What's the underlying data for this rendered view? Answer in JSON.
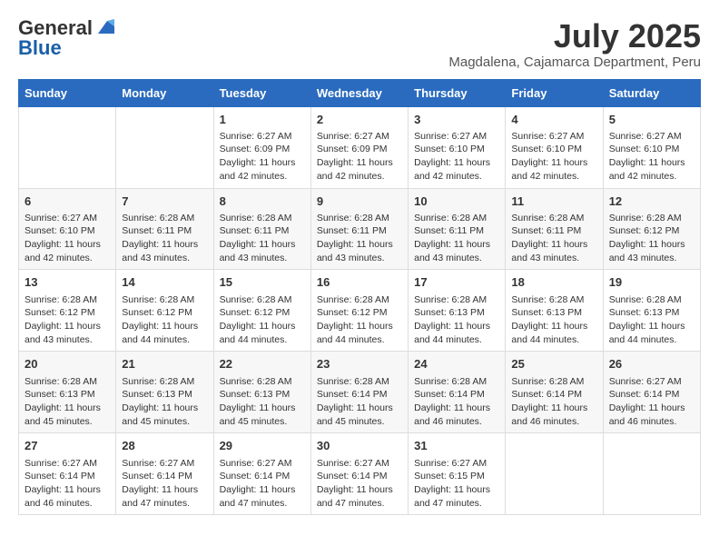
{
  "logo": {
    "general": "General",
    "blue": "Blue"
  },
  "title": {
    "month_year": "July 2025",
    "location": "Magdalena, Cajamarca Department, Peru"
  },
  "days_of_week": [
    "Sunday",
    "Monday",
    "Tuesday",
    "Wednesday",
    "Thursday",
    "Friday",
    "Saturday"
  ],
  "weeks": [
    [
      {
        "day": "",
        "info": ""
      },
      {
        "day": "",
        "info": ""
      },
      {
        "day": "1",
        "info": "Sunrise: 6:27 AM\nSunset: 6:09 PM\nDaylight: 11 hours and 42 minutes."
      },
      {
        "day": "2",
        "info": "Sunrise: 6:27 AM\nSunset: 6:09 PM\nDaylight: 11 hours and 42 minutes."
      },
      {
        "day": "3",
        "info": "Sunrise: 6:27 AM\nSunset: 6:10 PM\nDaylight: 11 hours and 42 minutes."
      },
      {
        "day": "4",
        "info": "Sunrise: 6:27 AM\nSunset: 6:10 PM\nDaylight: 11 hours and 42 minutes."
      },
      {
        "day": "5",
        "info": "Sunrise: 6:27 AM\nSunset: 6:10 PM\nDaylight: 11 hours and 42 minutes."
      }
    ],
    [
      {
        "day": "6",
        "info": "Sunrise: 6:27 AM\nSunset: 6:10 PM\nDaylight: 11 hours and 42 minutes."
      },
      {
        "day": "7",
        "info": "Sunrise: 6:28 AM\nSunset: 6:11 PM\nDaylight: 11 hours and 43 minutes."
      },
      {
        "day": "8",
        "info": "Sunrise: 6:28 AM\nSunset: 6:11 PM\nDaylight: 11 hours and 43 minutes."
      },
      {
        "day": "9",
        "info": "Sunrise: 6:28 AM\nSunset: 6:11 PM\nDaylight: 11 hours and 43 minutes."
      },
      {
        "day": "10",
        "info": "Sunrise: 6:28 AM\nSunset: 6:11 PM\nDaylight: 11 hours and 43 minutes."
      },
      {
        "day": "11",
        "info": "Sunrise: 6:28 AM\nSunset: 6:11 PM\nDaylight: 11 hours and 43 minutes."
      },
      {
        "day": "12",
        "info": "Sunrise: 6:28 AM\nSunset: 6:12 PM\nDaylight: 11 hours and 43 minutes."
      }
    ],
    [
      {
        "day": "13",
        "info": "Sunrise: 6:28 AM\nSunset: 6:12 PM\nDaylight: 11 hours and 43 minutes."
      },
      {
        "day": "14",
        "info": "Sunrise: 6:28 AM\nSunset: 6:12 PM\nDaylight: 11 hours and 44 minutes."
      },
      {
        "day": "15",
        "info": "Sunrise: 6:28 AM\nSunset: 6:12 PM\nDaylight: 11 hours and 44 minutes."
      },
      {
        "day": "16",
        "info": "Sunrise: 6:28 AM\nSunset: 6:12 PM\nDaylight: 11 hours and 44 minutes."
      },
      {
        "day": "17",
        "info": "Sunrise: 6:28 AM\nSunset: 6:13 PM\nDaylight: 11 hours and 44 minutes."
      },
      {
        "day": "18",
        "info": "Sunrise: 6:28 AM\nSunset: 6:13 PM\nDaylight: 11 hours and 44 minutes."
      },
      {
        "day": "19",
        "info": "Sunrise: 6:28 AM\nSunset: 6:13 PM\nDaylight: 11 hours and 44 minutes."
      }
    ],
    [
      {
        "day": "20",
        "info": "Sunrise: 6:28 AM\nSunset: 6:13 PM\nDaylight: 11 hours and 45 minutes."
      },
      {
        "day": "21",
        "info": "Sunrise: 6:28 AM\nSunset: 6:13 PM\nDaylight: 11 hours and 45 minutes."
      },
      {
        "day": "22",
        "info": "Sunrise: 6:28 AM\nSunset: 6:13 PM\nDaylight: 11 hours and 45 minutes."
      },
      {
        "day": "23",
        "info": "Sunrise: 6:28 AM\nSunset: 6:14 PM\nDaylight: 11 hours and 45 minutes."
      },
      {
        "day": "24",
        "info": "Sunrise: 6:28 AM\nSunset: 6:14 PM\nDaylight: 11 hours and 46 minutes."
      },
      {
        "day": "25",
        "info": "Sunrise: 6:28 AM\nSunset: 6:14 PM\nDaylight: 11 hours and 46 minutes."
      },
      {
        "day": "26",
        "info": "Sunrise: 6:27 AM\nSunset: 6:14 PM\nDaylight: 11 hours and 46 minutes."
      }
    ],
    [
      {
        "day": "27",
        "info": "Sunrise: 6:27 AM\nSunset: 6:14 PM\nDaylight: 11 hours and 46 minutes."
      },
      {
        "day": "28",
        "info": "Sunrise: 6:27 AM\nSunset: 6:14 PM\nDaylight: 11 hours and 47 minutes."
      },
      {
        "day": "29",
        "info": "Sunrise: 6:27 AM\nSunset: 6:14 PM\nDaylight: 11 hours and 47 minutes."
      },
      {
        "day": "30",
        "info": "Sunrise: 6:27 AM\nSunset: 6:14 PM\nDaylight: 11 hours and 47 minutes."
      },
      {
        "day": "31",
        "info": "Sunrise: 6:27 AM\nSunset: 6:15 PM\nDaylight: 11 hours and 47 minutes."
      },
      {
        "day": "",
        "info": ""
      },
      {
        "day": "",
        "info": ""
      }
    ]
  ]
}
